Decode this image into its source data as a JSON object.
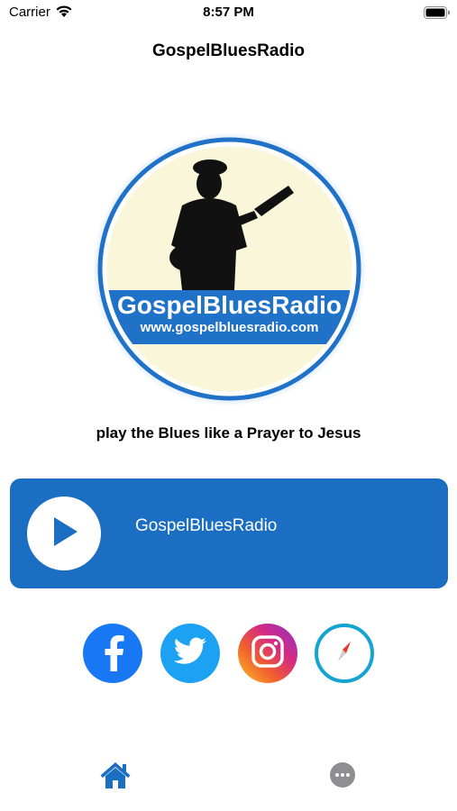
{
  "status_bar": {
    "carrier": "Carrier",
    "time": "8:57 PM"
  },
  "nav": {
    "title": "GospelBluesRadio"
  },
  "logo": {
    "brand": "GospelBluesRadio",
    "url": "www.gospelbluesradio.com"
  },
  "tagline": "play the Blues like  a Prayer to Jesus",
  "player": {
    "station_name": "GospelBluesRadio",
    "play_icon": "play-icon"
  },
  "social": [
    {
      "name": "facebook-icon"
    },
    {
      "name": "twitter-icon"
    },
    {
      "name": "instagram-icon"
    },
    {
      "name": "safari-compass-icon"
    }
  ],
  "tab_bar": {
    "items": [
      "home-icon",
      "more-icon"
    ]
  },
  "colors": {
    "accent": "#1b6ec2",
    "logo_bg": "#faf6d9",
    "facebook": "#1877f2",
    "twitter": "#1da1f2",
    "compass": "#15a3d2"
  }
}
